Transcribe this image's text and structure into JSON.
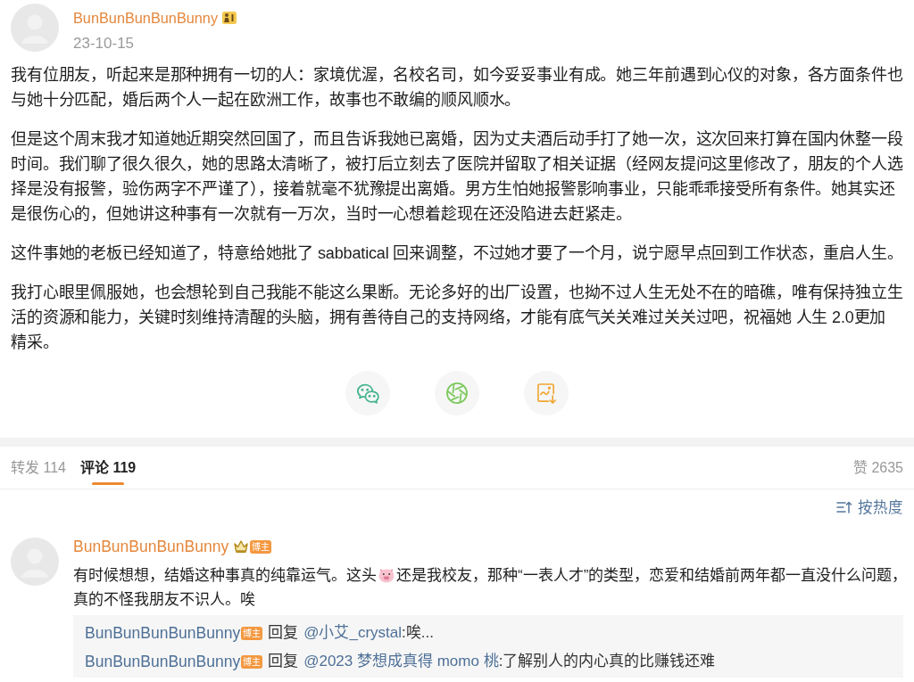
{
  "post": {
    "author": {
      "name": "BunBunBunBunBunny"
    },
    "date": "23-10-15",
    "paragraphs": [
      {
        "lines": [
          "我有位朋友，听起来是那种拥有一切的人：家境优渥，名校名司，如今妥妥事业有成。她三年前遇到心仪的对象，各方面条件也",
          "与她十分匹配，婚后两个人一起在欧洲工作，故事也不敢编的顺风顺水。"
        ]
      },
      {
        "lines": [
          "但是这个周末我才知道她近期突然回国了，而且告诉我她已离婚，因为丈夫酒后动手打了她一次，这次回来打算在国内休整一段",
          "时间。我们聊了很久很久，她的思路太清晰了，被打后立刻去了医院并留取了相关证据（经网友提问这里修改了，朋友的个人选",
          "择是没有报警，验伤两字不严谨了），接着就毫不犹豫提出离婚。男方生怕她报警影响事业，只能乖乖接受所有条件。她其实还",
          "是很伤心的，但她讲这种事有一次就有一万次，当时一心想着趁现在还没陷进去赶紧走。"
        ]
      },
      {
        "lines": [
          "这件事她的老板已经知道了，特意给她批了 sabbatical 回来调整，不过她才要了一个月，说宁愿早点回到工作状态，重启人生。"
        ]
      },
      {
        "lines": [
          "我打心眼里佩服她，也会想轮到自己我能不能这么果断。无论多好的出厂设置，也拗不过人生无处不在的暗礁，唯有保持独立生",
          "活的资源和能力，关键时刻维持清醒的头脑，拥有善待自己的支持网络，才能有底气关关难过关关过吧，祝福她 人生 2.0更加",
          "精采。"
        ]
      }
    ]
  },
  "share_actions": [
    {
      "kind": "wechat"
    },
    {
      "kind": "moments"
    },
    {
      "kind": "save_image"
    }
  ],
  "tabs": [
    {
      "label": "转发 114",
      "selected": false
    },
    {
      "label": "评论 119",
      "selected": true
    }
  ],
  "likes": {
    "label": "赞 2635"
  },
  "sort": {
    "label": "按热度"
  },
  "comments": [
    {
      "author": "BunBunBunBunBunny",
      "tag": "博主",
      "lines": [
        [
          {
            "kind": "text",
            "text": "有时候想想，结婚这种事真的纯靠运气。这头"
          },
          {
            "kind": "emoji"
          },
          {
            "kind": "text",
            "text": "还是我校友，那种“一表人才”的类型，恋爱和结婚前两年都一直没什么问题，"
          }
        ],
        [
          {
            "kind": "text",
            "text": "真的不怪我朋友不识人。唉"
          }
        ]
      ],
      "replies": [
        {
          "author": "BunBunBunBunBunny",
          "tag": "博主",
          "action": "回复",
          "target": "@小艾_crystal",
          "text": ":唉..."
        },
        {
          "author": "BunBunBunBunBunny",
          "tag": "博主",
          "action": "回复",
          "target": "@2023 梦想成真得 momo 桃",
          "text": ":了解别人的内心真的比赚钱还难"
        }
      ]
    }
  ]
}
